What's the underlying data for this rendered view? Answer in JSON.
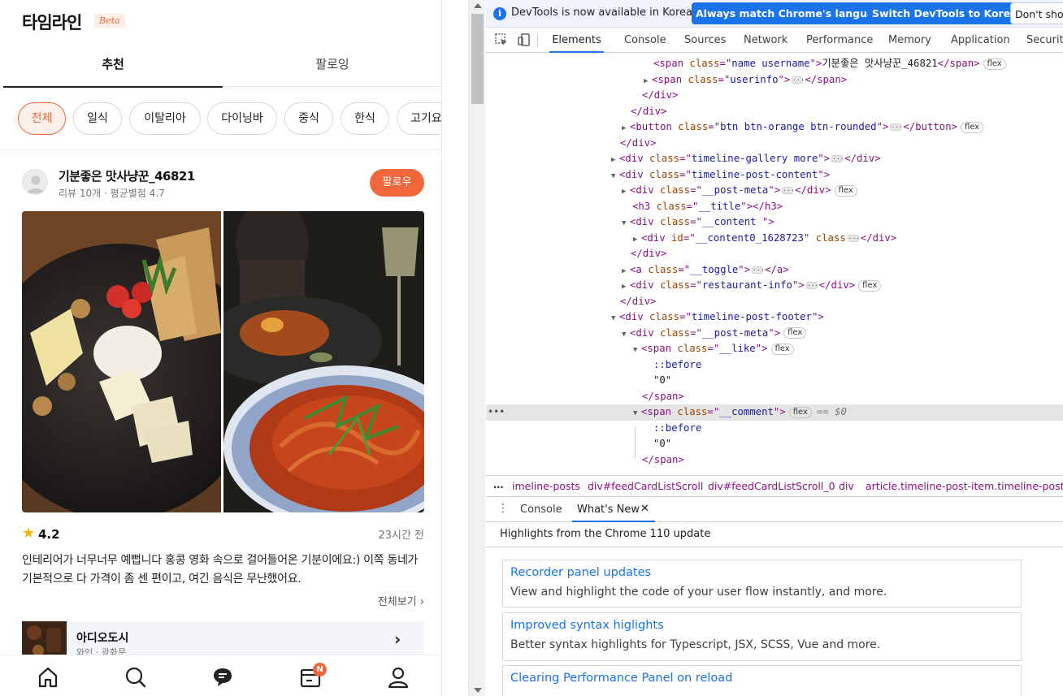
{
  "app": {
    "title": "타임라인",
    "beta": "Beta",
    "tabs": [
      "추천",
      "팔로잉"
    ],
    "chips": [
      "전체",
      "일식",
      "이탈리아",
      "다이닝바",
      "중식",
      "한식",
      "고기요"
    ],
    "post": {
      "username": "기분좋은 맛사냥꾼_46821",
      "userinfo": "리뷰 10개 · 평균별점 4.7",
      "follow": "팔로우",
      "rating": "4.2",
      "time_ago": "23시간 전",
      "body": "인테리어가 너무너무 예뻡니다 홍콩 영화 속으로 걸어들어온 기분이에요:) 이쪽 동네가 기본적으로 다 가격이 좀 센 편이고, 여긴 음식은 무난했어요.",
      "see_all": "전체보기",
      "restaurant_name": "아디오도시",
      "restaurant_location": "와인 · 광화문"
    },
    "nav_badge": "N"
  },
  "devtools": {
    "infobar": {
      "text": "DevTools is now available in Korean!",
      "btn_match": "Always match Chrome's language",
      "btn_switch": "Switch DevTools to Korean",
      "btn_dont": "Don't sho"
    },
    "tabs": [
      "Elements",
      "Console",
      "Sources",
      "Network",
      "Performance",
      "Memory",
      "Application",
      "Security"
    ],
    "dom": {
      "l0_cls": "name username",
      "l0_text": "기분좋은 맛사냥꾼_46821",
      "l1_cls": "userinfo",
      "l4_cls": "btn btn-orange btn-rounded",
      "l6_cls": "timeline-gallery more",
      "l7_cls": "timeline-post-content",
      "l8_cls": "__post-meta",
      "l9_cls": "__title",
      "l10_cls": "__content ",
      "l11_id": "__content0_1628723",
      "l13_cls": "__toggle",
      "l14_cls": "restaurant-info",
      "l16_cls": "timeline-post-footer",
      "l17_cls": "__post-meta",
      "l18_cls": "__like",
      "pseudo_before": "::before",
      "zero": "\"0\"",
      "l22_cls": "__comment",
      "eq0": "== $0",
      "flex": "flex"
    },
    "breadcrumbs": [
      "imeline-posts",
      "div#feedCardListScroll",
      "div#feedCardListScroll_0",
      "div",
      "article.timeline-post-item.timeline-post-it"
    ],
    "drawer_tabs": [
      "Console",
      "What's New"
    ],
    "whats_new_title": "Highlights from the Chrome 110 update",
    "cards": [
      {
        "title": "Recorder panel updates",
        "desc": "View and highlight the code of your user flow instantly, and more."
      },
      {
        "title": "Improved syntax higlights",
        "desc": "Better syntax highlights for Typescript, JSX, SCSS, Vue and more."
      },
      {
        "title": "Clearing Performance Panel on reload",
        "desc": ""
      }
    ]
  },
  "colors": {
    "brand_orange": "#f0673b",
    "devtools_blue": "#1a73e8",
    "star": "#f5b400"
  }
}
